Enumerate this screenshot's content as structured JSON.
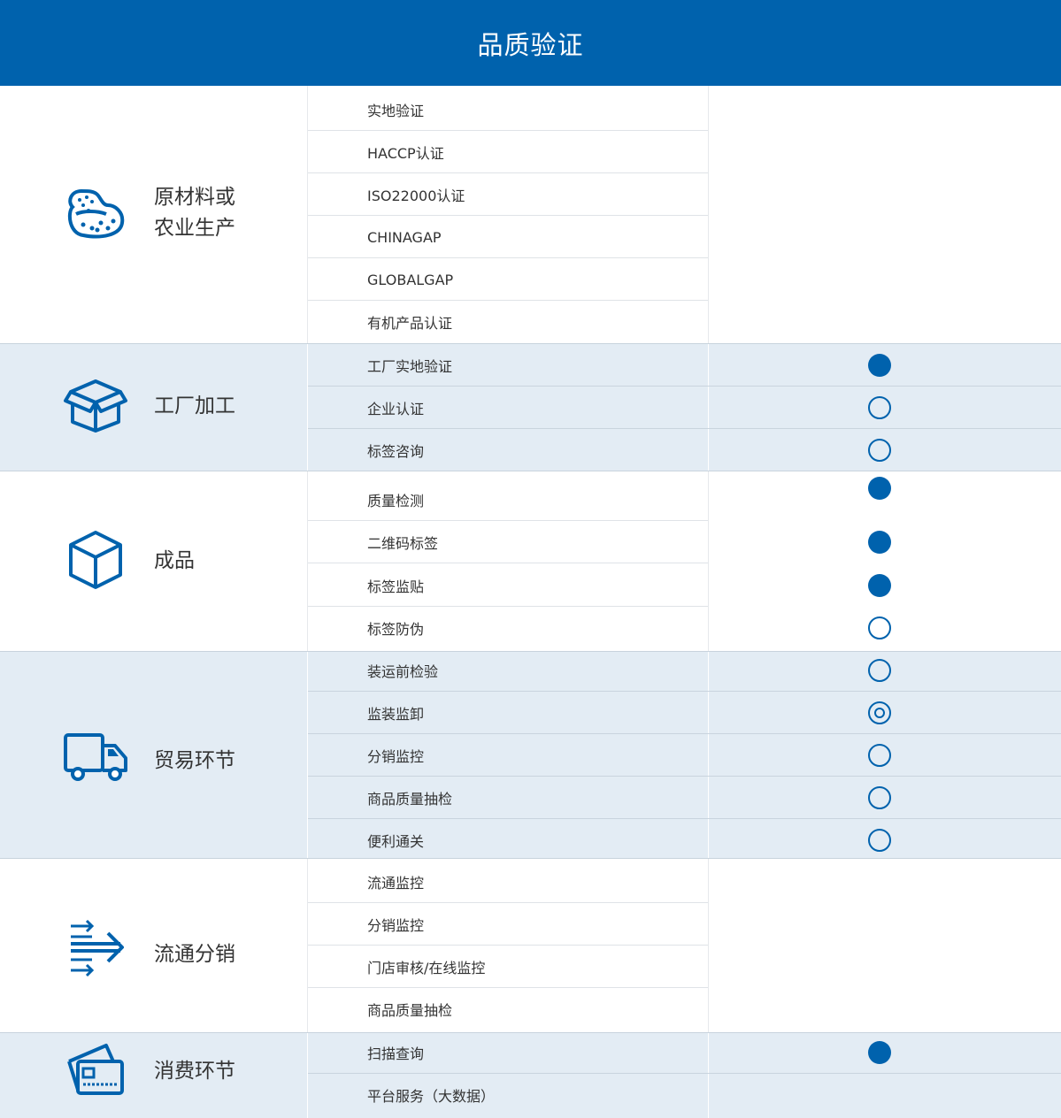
{
  "header": {
    "title": "品质验证"
  },
  "sections": [
    {
      "label": "原材料或\n农业生产",
      "icon": "potato-icon",
      "items": [
        {
          "label": "实地验证",
          "status": "none"
        },
        {
          "label": "HACCP认证",
          "status": "none"
        },
        {
          "label": "ISO22000认证",
          "status": "none"
        },
        {
          "label": "CHINAGAP",
          "status": "none"
        },
        {
          "label": "GLOBALGAP",
          "status": "none"
        },
        {
          "label": "有机产品认证",
          "status": "none"
        }
      ]
    },
    {
      "label": "工厂加工",
      "icon": "open-box-icon",
      "items": [
        {
          "label": "工厂实地验证",
          "status": "filled"
        },
        {
          "label": "企业认证",
          "status": "empty"
        },
        {
          "label": "标签咨询",
          "status": "empty"
        }
      ]
    },
    {
      "label": "成品",
      "icon": "box-icon",
      "items": [
        {
          "label": "质量检测",
          "status": "filled"
        },
        {
          "label": "二维码标签",
          "status": "filled"
        },
        {
          "label": "标签监贴",
          "status": "filled"
        },
        {
          "label": "标签防伪",
          "status": "empty"
        }
      ]
    },
    {
      "label": "贸易环节",
      "icon": "truck-icon",
      "items": [
        {
          "label": "装运前检验",
          "status": "empty"
        },
        {
          "label": "监装监卸",
          "status": "ring"
        },
        {
          "label": "分销监控",
          "status": "empty"
        },
        {
          "label": "商品质量抽检",
          "status": "empty"
        },
        {
          "label": "便利通关",
          "status": "empty"
        }
      ]
    },
    {
      "label": "流通分销",
      "icon": "arrows-icon",
      "items": [
        {
          "label": "流通监控",
          "status": "none"
        },
        {
          "label": "分销监控",
          "status": "none"
        },
        {
          "label": "门店审核/在线监控",
          "status": "none"
        },
        {
          "label": "商品质量抽检",
          "status": "none"
        }
      ]
    },
    {
      "label": "消费环节",
      "icon": "card-icon",
      "items": [
        {
          "label": "扫描查询",
          "status": "filled"
        },
        {
          "label": "平台服务（大数据）",
          "status": "none"
        }
      ]
    }
  ],
  "colors": {
    "brand": "#0062ad",
    "shaded_row": "#e3ecf4"
  }
}
